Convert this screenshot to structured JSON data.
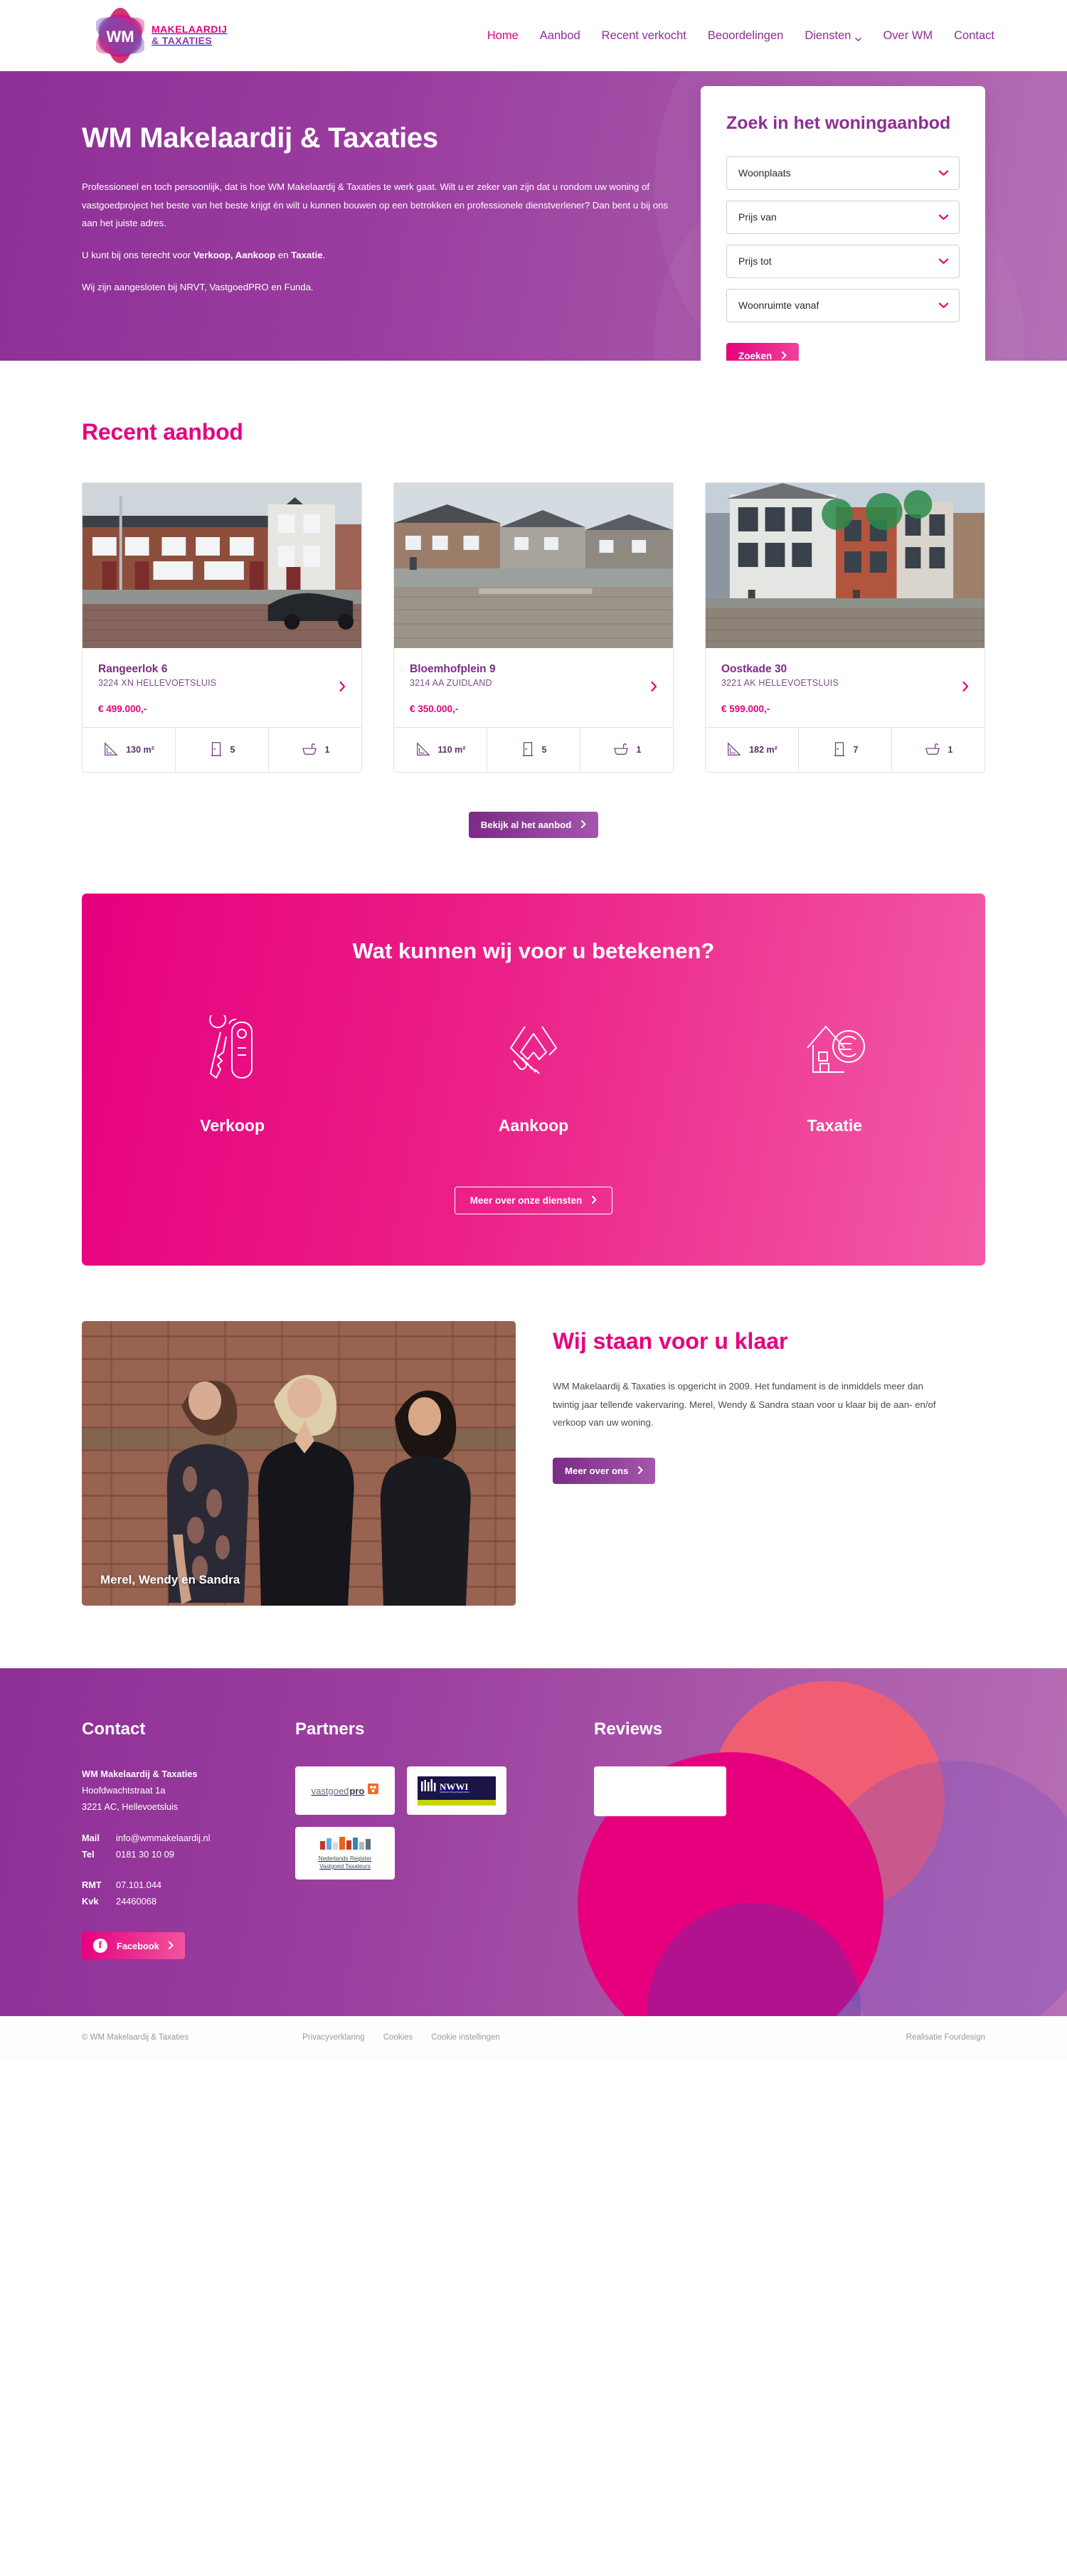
{
  "header": {
    "logo": {
      "line1": "MAKELAARDIJ",
      "line2": "& TAXATIES",
      "mark_text": "WM"
    },
    "nav": [
      {
        "label": "Home",
        "active": true
      },
      {
        "label": "Aanbod",
        "active": false
      },
      {
        "label": "Recent verkocht",
        "active": false
      },
      {
        "label": "Beoordelingen",
        "active": false
      },
      {
        "label": "Diensten",
        "active": false,
        "has_dropdown": true
      },
      {
        "label": "Over WM",
        "active": false
      },
      {
        "label": "Contact",
        "active": false
      }
    ]
  },
  "hero": {
    "title": "WM Makelaardij & Taxaties",
    "paragraph1": "Professioneel en toch persoonlijk, dat is hoe WM Makelaardij & Taxaties te werk gaat. Wilt u er zeker van zijn dat u rondom uw woning of vastgoedproject het beste van het beste krijgt én wilt u kunnen bouwen op een betrokken en professionele dienstverlener? Dan bent u bij ons aan het juiste adres.",
    "paragraph2_prefix": "U kunt bij ons terecht voor ",
    "paragraph2_bold1": "Verkoop, Aankoop",
    "paragraph2_mid": " en ",
    "paragraph2_bold2": "Taxatie",
    "paragraph2_suffix": ".",
    "paragraph3": "Wij zijn aangesloten bij NRVT, VastgoedPRO en Funda."
  },
  "search": {
    "title": "Zoek in het woningaanbod",
    "fields": [
      {
        "label": "Woonplaats"
      },
      {
        "label": "Prijs van"
      },
      {
        "label": "Prijs tot"
      },
      {
        "label": "Woonruimte vanaf"
      }
    ],
    "submit_label": "Zoeken"
  },
  "recent": {
    "title": "Recent aanbod",
    "cta_label": "Bekijk al het aanbod",
    "properties": [
      {
        "address": "Rangeerlok 6",
        "zip": "3224 XN HELLEVOETSLUIS",
        "price": "€ 499.000,-",
        "area": "130 m²",
        "rooms": "5",
        "bathrooms": "1"
      },
      {
        "address": "Bloemhofplein 9",
        "zip": "3214 AA ZUIDLAND",
        "price": "€ 350.000,-",
        "area": "110 m²",
        "rooms": "5",
        "bathrooms": "1"
      },
      {
        "address": "Oostkade 30",
        "zip": "3221 AK HELLEVOETSLUIS",
        "price": "€ 599.000,-",
        "area": "182 m²",
        "rooms": "7",
        "bathrooms": "1"
      }
    ]
  },
  "services": {
    "title": "Wat kunnen wij voor u betekenen?",
    "items": [
      {
        "label": "Verkoop",
        "icon": "keys-icon"
      },
      {
        "label": "Aankoop",
        "icon": "handshake-icon"
      },
      {
        "label": "Taxatie",
        "icon": "house-euro-icon"
      }
    ],
    "cta_label": "Meer over onze diensten"
  },
  "about": {
    "photo_caption": "Merel, Wendy en Sandra",
    "title": "Wij staan voor u klaar",
    "body": "WM Makelaardij & Taxaties is opgericht in 2009. Het fundament is de inmiddels meer dan twintig jaar tellende vakervaring. Merel, Wendy & Sandra staan voor u klaar bij de aan- en/of verkoop van uw woning.",
    "cta_label": "Meer over ons"
  },
  "footer": {
    "contact": {
      "heading": "Contact",
      "company": "WM Makelaardij & Taxaties",
      "street": "Hoofdwachtstraat 1a",
      "city": "3221 AC, Hellevoetsluis",
      "mail_key": "Mail",
      "mail_value": "info@wmmakelaardij.nl",
      "tel_key": "Tel",
      "tel_value": "0181 30 10 09",
      "rmt_key": "RMT",
      "rmt_value": "07.101.044",
      "kvk_key": "Kvk",
      "kvk_value": "24460068",
      "facebook_label": "Facebook"
    },
    "partners": {
      "heading": "Partners",
      "items": [
        {
          "name": "vastgoedpro",
          "text_a": "vastgoed",
          "text_b": "pro"
        },
        {
          "name": "NWWI",
          "text_a": "NWWI",
          "text_b": "Nederlands Woning Waarde Instituut"
        },
        {
          "name": "Nederlands Register Vastgoed Taxateurs",
          "text_a": "Nederlands Register",
          "text_b": "Vastgoed Taxateurs"
        }
      ]
    },
    "reviews": {
      "heading": "Reviews"
    }
  },
  "bottombar": {
    "copyright": "© WM Makelaardij & Taxaties",
    "links": [
      {
        "label": "Privacyverklaring"
      },
      {
        "label": "Cookies"
      },
      {
        "label": "Cookie instellingen"
      }
    ],
    "credit": "Realisatie Fourdesign"
  },
  "colors": {
    "pink": "#e6007e",
    "purple": "#8d2f94",
    "purple_dark": "#7c2b86"
  }
}
